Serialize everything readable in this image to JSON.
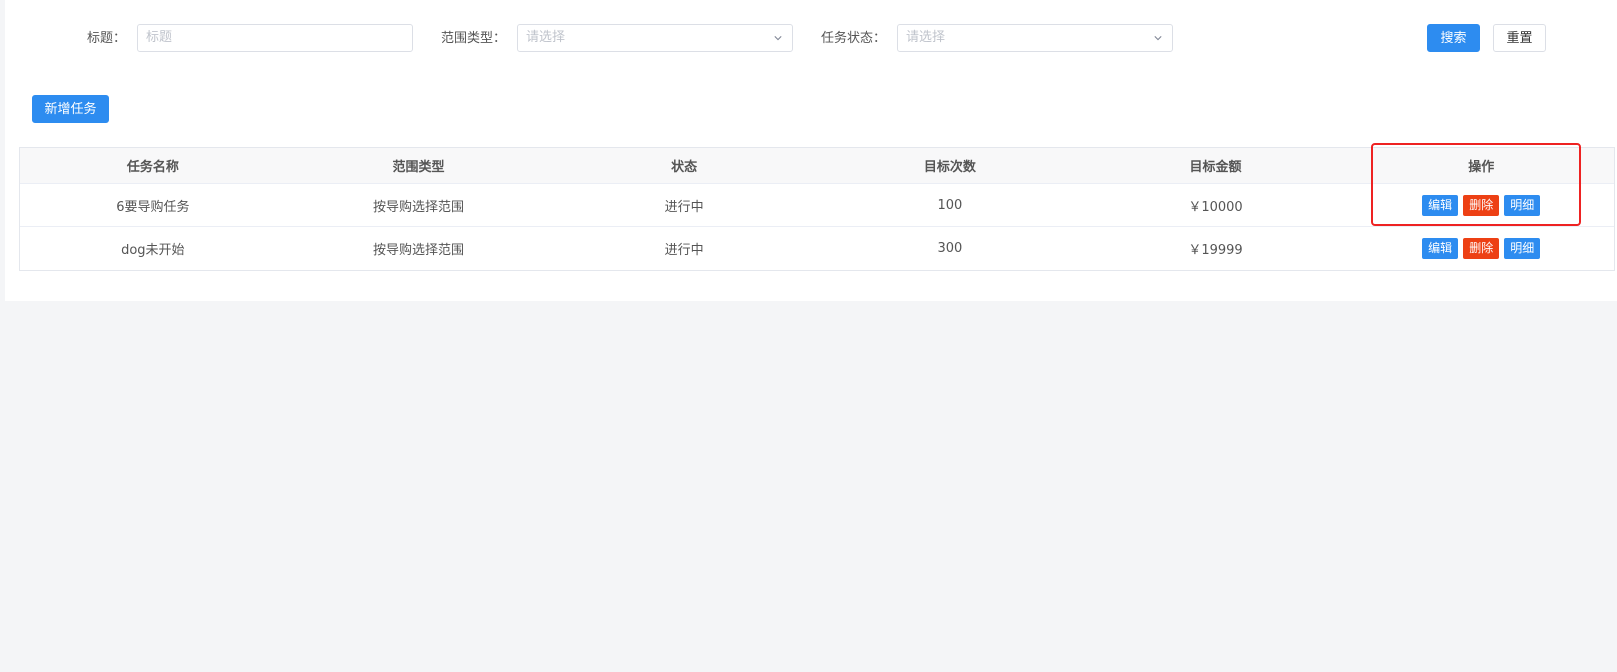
{
  "filters": {
    "title_label": "标题：",
    "title_placeholder": "标题",
    "scope_label": "范围类型：",
    "scope_placeholder": "请选择",
    "status_label": "任务状态：",
    "status_placeholder": "请选择",
    "search_button": "搜索",
    "reset_button": "重置"
  },
  "toolbar": {
    "add_button": "新增任务"
  },
  "table": {
    "columns": [
      "任务名称",
      "范围类型",
      "状态",
      "目标次数",
      "目标金额",
      "操作"
    ],
    "rows": [
      {
        "name": "6要导购任务",
        "scope": "按导购选择范围",
        "status": "进行中",
        "target_count": "100",
        "target_amount": "￥10000"
      },
      {
        "name": "dog未开始",
        "scope": "按导购选择范围",
        "status": "进行中",
        "target_count": "300",
        "target_amount": "￥19999"
      }
    ],
    "actions": {
      "edit": "编辑",
      "delete": "删除",
      "detail": "明细"
    }
  },
  "colors": {
    "primary": "#2d8cf0",
    "danger": "#ed4014",
    "highlight": "#ee2222"
  }
}
